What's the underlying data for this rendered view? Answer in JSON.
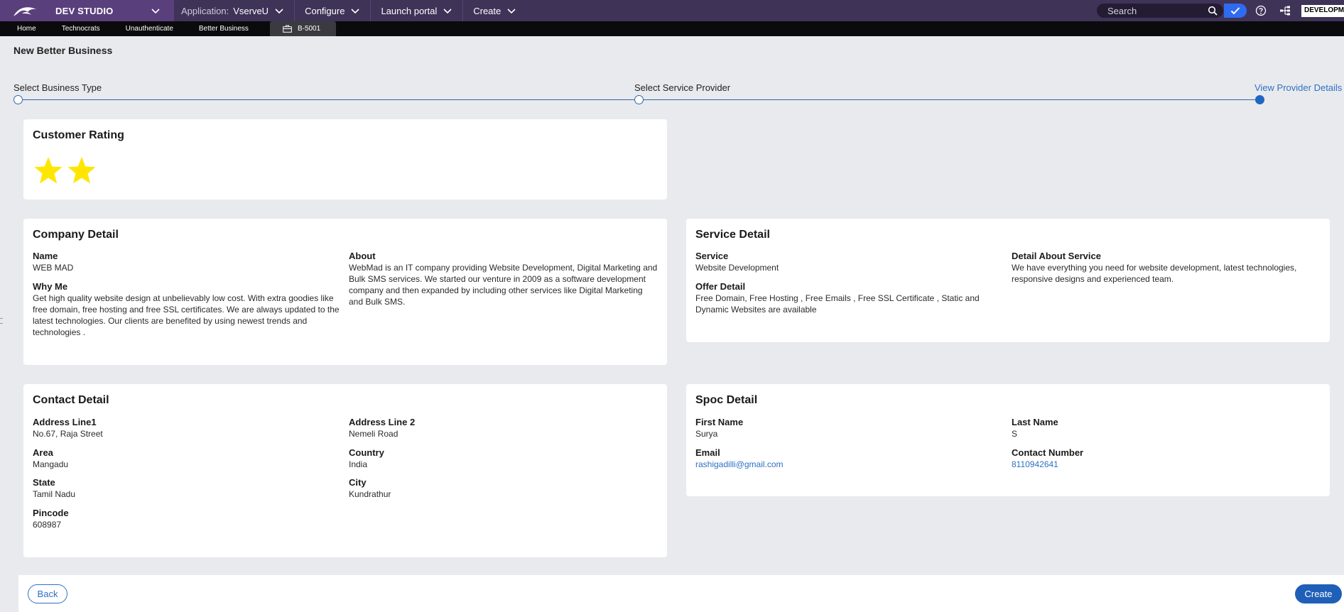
{
  "header": {
    "brand": "DEV STUDIO",
    "menu": [
      {
        "muted": "Application:",
        "label": "VserveU"
      },
      {
        "muted": "",
        "label": "Configure"
      },
      {
        "muted": "",
        "label": "Launch portal"
      },
      {
        "muted": "",
        "label": "Create"
      }
    ],
    "search_placeholder": "Search",
    "environment": "DEVELOPMENT"
  },
  "tabs": [
    "Home",
    "Technocrats",
    "Unauthenticate",
    "Better Business",
    "B-5001"
  ],
  "page_title": "New Better Business",
  "steps": [
    "Select Business Type",
    "Select Service Provider",
    "View Provider Details"
  ],
  "rating": {
    "title": "Customer Rating",
    "stars": 2,
    "star_color": "#ffe600"
  },
  "company": {
    "title": "Company Detail",
    "name_label": "Name",
    "name": "WEB MAD",
    "about_label": "About",
    "about": "WebMad is an IT company providing Website Development, Digital Marketing and Bulk SMS services. We started our venture in 2009 as a software development company and then expanded by including other services like Digital Marketing and Bulk SMS.",
    "why_label": "Why Me",
    "why": "Get high quality website design at unbelievably low cost. With extra goodies like free domain, free hosting and free SSL certificates. We are always updated to the latest technologies. Our clients are benefited by using newest trends and technologies ."
  },
  "service": {
    "title": "Service Detail",
    "service_label": "Service",
    "service": "Website Development",
    "detail_label": "Detail About Service",
    "detail": "We have everything you need for website development, latest technologies, responsive designs and experienced team.",
    "offer_label": "Offer Detail",
    "offer": "Free Domain, Free Hosting , Free Emails , Free SSL Certificate , Static and Dynamic Websites are available"
  },
  "contact": {
    "title": "Contact Detail",
    "address1_label": "Address Line1",
    "address1": "No.67, Raja Street",
    "address2_label": "Address Line 2",
    "address2": "Nemeli Road",
    "area_label": "Area",
    "area": "Mangadu",
    "country_label": "Country",
    "country": "India",
    "state_label": "State",
    "state": "Tamil Nadu",
    "city_label": "City",
    "city": "Kundrathur",
    "pincode_label": "Pincode",
    "pincode": "608987"
  },
  "spoc": {
    "title": "Spoc Detail",
    "first_label": "First Name",
    "first": "Surya",
    "last_label": "Last Name",
    "last": "S",
    "email_label": "Email",
    "email": "rashigadilli@gmail.com",
    "phone_label": "Contact Number",
    "phone": "8110942641"
  },
  "footer": {
    "back": "Back",
    "create": "Create"
  },
  "colors": {
    "header": "#3f3358",
    "brand": "#5a3f7d",
    "accent": "#1f5fb8",
    "link": "#2e71c4"
  }
}
